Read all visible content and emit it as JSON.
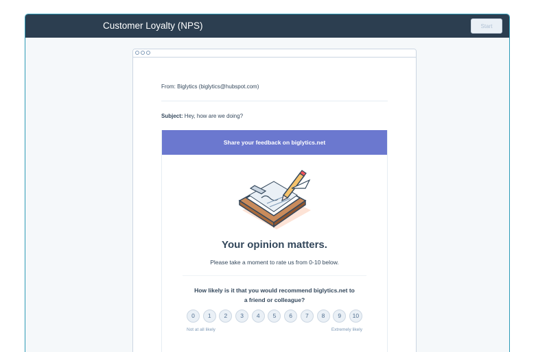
{
  "header": {
    "title": "Customer Loyalty (NPS)",
    "start_label": "Start"
  },
  "email": {
    "from_label": "From:",
    "from_value": " Biglytics (biglytics@hubspot.com)",
    "subject_label": "Subject:",
    "subject_value": " Hey, how are we doing?",
    "banner": "Share your feedback on biglytics.net",
    "heading": "Your opinion matters.",
    "subtext": "Please take a moment to rate us from 0-10 below.",
    "question_line1": "How likely is it that you would recommend biglytics.net to",
    "question_line2": "a friend or colleague?",
    "scale": [
      "0",
      "1",
      "2",
      "3",
      "4",
      "5",
      "6",
      "7",
      "8",
      "9",
      "10"
    ],
    "low_label": "Not at all likely",
    "high_label": "Extremely likely"
  },
  "colors": {
    "header_bg": "#2c3e50",
    "banner_bg": "#6b78cf",
    "accent_border": "#2b9ab5"
  },
  "icons": {
    "illustration": "clipboard-pencil-illustration"
  }
}
